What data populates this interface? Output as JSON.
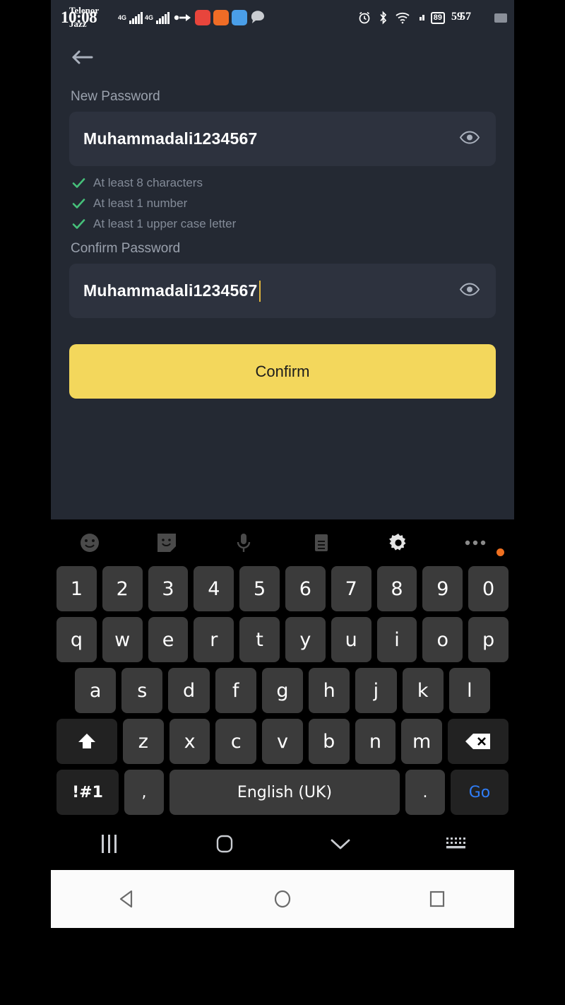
{
  "status_bar": {
    "time": "10:08",
    "carrier_1": "Telenor",
    "carrier_2": "Jazz",
    "network_1": "4G",
    "network_2": "4G",
    "battery_box_percent": "89",
    "battery_percent_overlap_1": "59",
    "battery_percent_overlap_2": "57",
    "icons": [
      "alarm-icon",
      "bluetooth-icon",
      "wifi-icon",
      "signal-icon",
      "battery-icon"
    ],
    "app_icons": [
      "music-app-icon",
      "tiktok-app-icon",
      "messenger-blue-icon",
      "chat-bubble-icon"
    ]
  },
  "app": {
    "back_label": "back-arrow",
    "new_password": {
      "label": "New Password",
      "value": "Muhammadali1234567",
      "toggle": "show-password"
    },
    "rules": [
      {
        "text": "At least 8 characters",
        "met": true
      },
      {
        "text": "At least 1 number",
        "met": true
      },
      {
        "text": "At least 1 upper case letter",
        "met": true
      }
    ],
    "confirm_password": {
      "label": "Confirm Password",
      "value": "Muhammadali1234567",
      "toggle": "show-password"
    },
    "submit_label": "Confirm",
    "colors": {
      "background": "#242933",
      "field": "#2d323e",
      "accent": "#F3D75C",
      "check": "#46c07a",
      "caret": "#e0b53c",
      "label_text": "#9aa1ad"
    }
  },
  "keyboard": {
    "toolbar": [
      "emoji-icon",
      "sticker-icon",
      "microphone-icon",
      "clipboard-icon",
      "settings-gear-icon",
      "more-options-icon"
    ],
    "rows": {
      "numbers": [
        "1",
        "2",
        "3",
        "4",
        "5",
        "6",
        "7",
        "8",
        "9",
        "0"
      ],
      "top": [
        "q",
        "w",
        "e",
        "r",
        "t",
        "y",
        "u",
        "i",
        "o",
        "p"
      ],
      "home": [
        "a",
        "s",
        "d",
        "f",
        "g",
        "h",
        "j",
        "k",
        "l"
      ],
      "bottom": [
        "z",
        "x",
        "c",
        "v",
        "b",
        "n",
        "m"
      ]
    },
    "shift_label": "shift-key",
    "backspace_label": "backspace-key",
    "symbols_label": "!#1",
    "comma_label": ",",
    "space_label": "English (UK)",
    "period_label": ".",
    "enter_label": "Go"
  },
  "nav_bar": {
    "keyboard_nav": [
      "recent-apps-icon",
      "home-icon",
      "hide-keyboard-icon",
      "switch-keyboard-icon"
    ],
    "system_nav": [
      "back-icon",
      "home-icon",
      "recents-icon"
    ]
  }
}
